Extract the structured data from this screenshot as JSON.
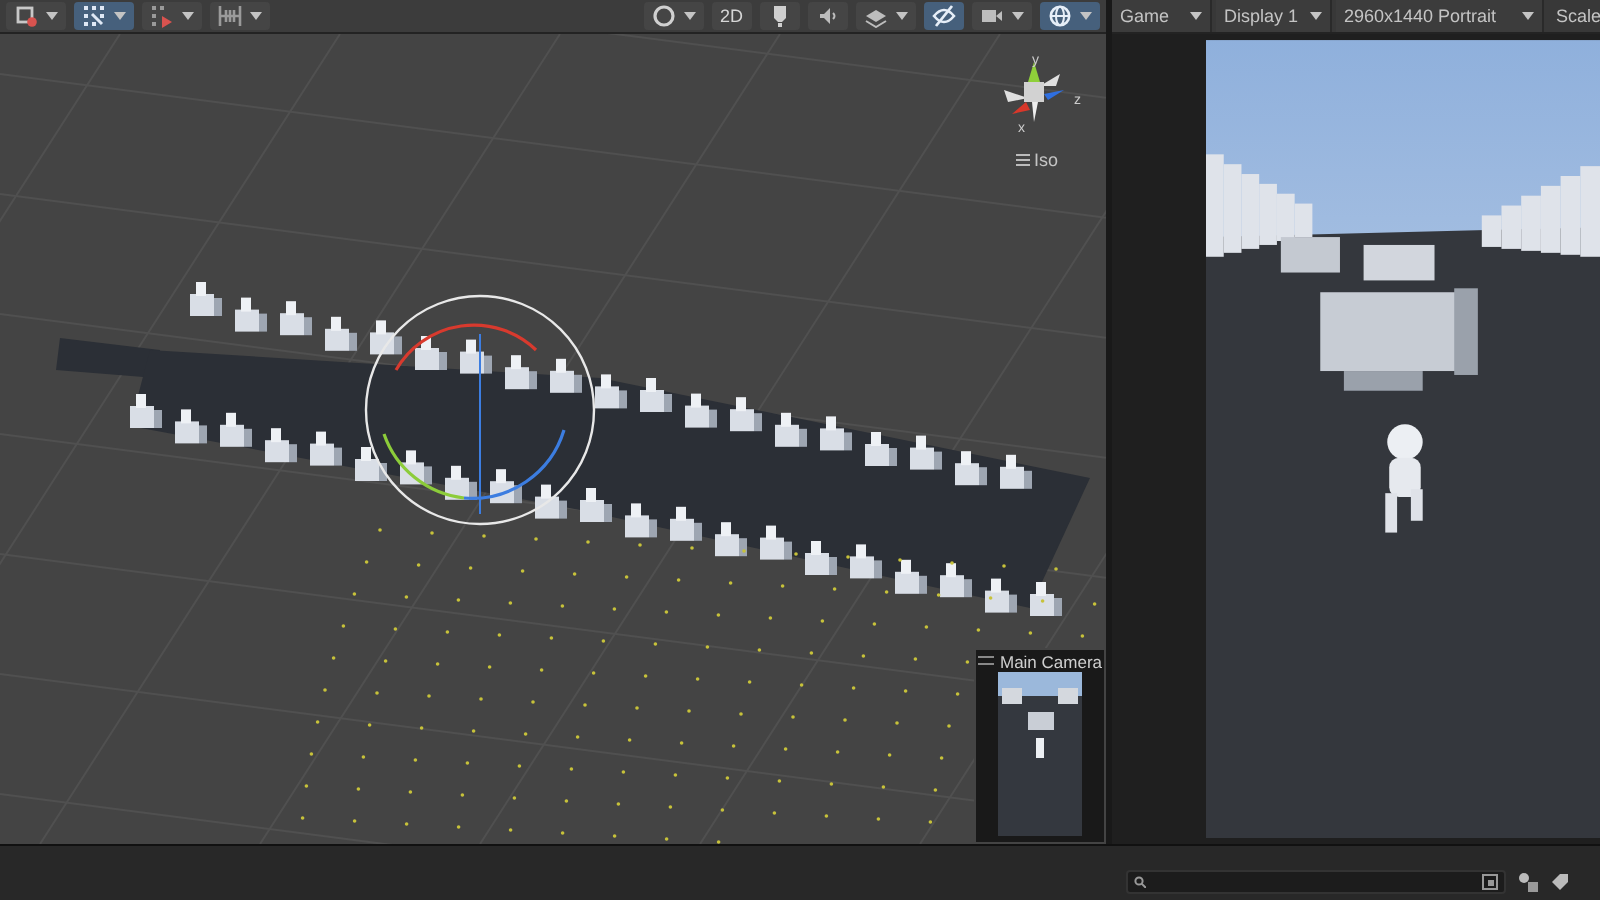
{
  "scene_toolbar": {
    "left": [
      {
        "kind": "tool",
        "selected": false,
        "dropdown": true
      },
      {
        "kind": "grid",
        "selected": true,
        "dropdown": true
      },
      {
        "kind": "increment",
        "selected": false,
        "dropdown": true
      },
      {
        "kind": "align",
        "selected": false,
        "dropdown": true
      }
    ],
    "right": [
      {
        "kind": "shading",
        "selected": false,
        "dropdown": true
      },
      {
        "kind": "dimension",
        "label": "2D",
        "selected": false,
        "dropdown": false
      },
      {
        "kind": "light",
        "selected": false,
        "dropdown": false
      },
      {
        "kind": "audio",
        "selected": false,
        "dropdown": false
      },
      {
        "kind": "effects",
        "selected": false,
        "dropdown": true
      },
      {
        "kind": "visibility",
        "selected": true,
        "dropdown": false
      },
      {
        "kind": "camera",
        "selected": false,
        "dropdown": true
      },
      {
        "kind": "gizmos",
        "selected": true,
        "dropdown": true
      }
    ]
  },
  "orientation_gizmo": {
    "axes": [
      "y",
      "z",
      "x"
    ],
    "projection": "Iso"
  },
  "camera_preview": {
    "title": "Main Camera"
  },
  "game_toolbar": {
    "tab": "Game",
    "display": "Display 1",
    "resolution": "2960x1440 Portrait",
    "scale": "Scale"
  }
}
